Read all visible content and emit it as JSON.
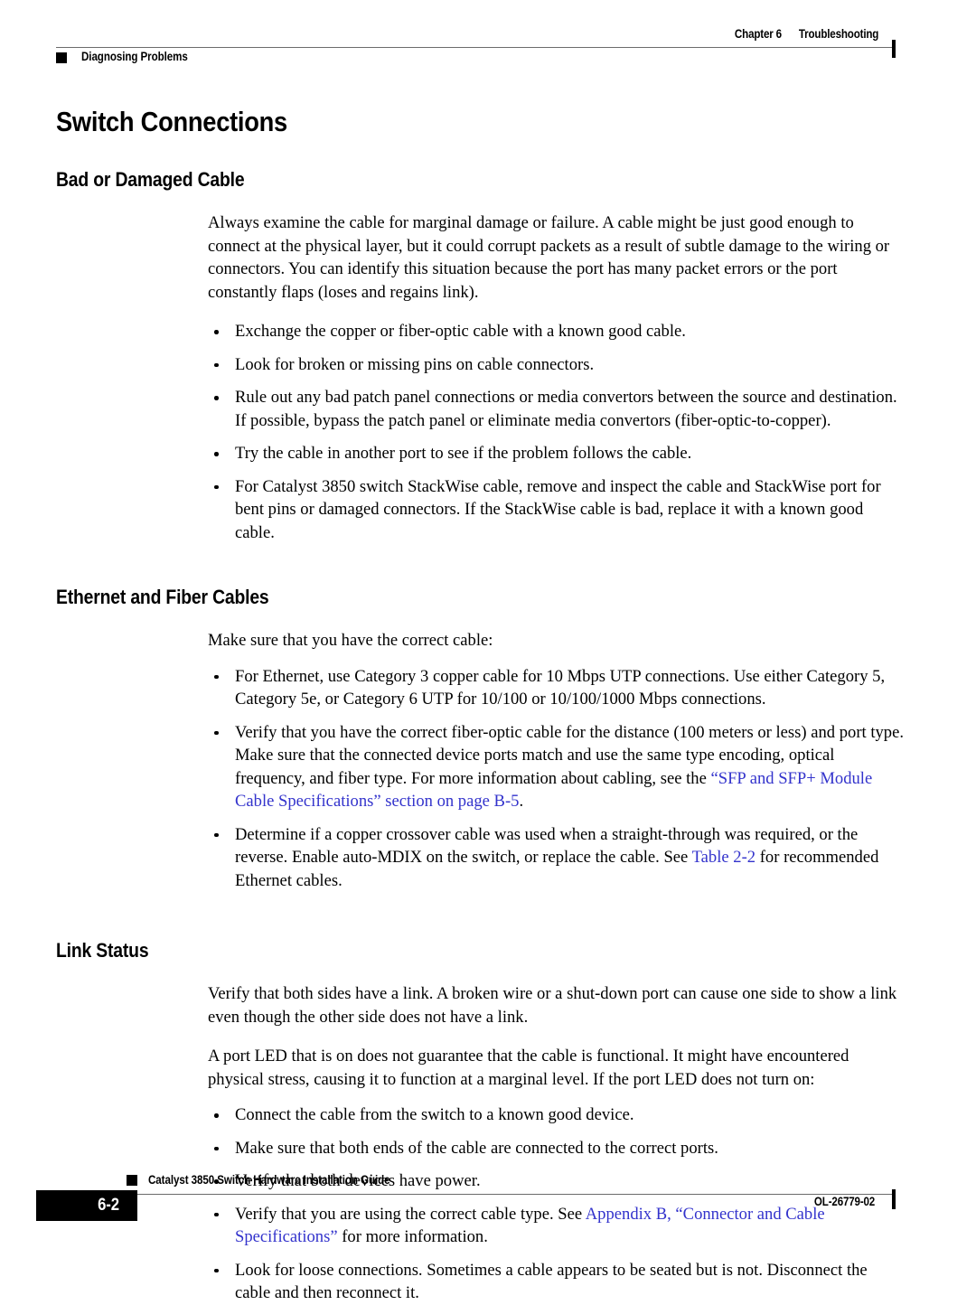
{
  "header": {
    "chapter_number": "Chapter 6",
    "chapter_title": "Troubleshooting",
    "section_name": "Diagnosing Problems"
  },
  "footer": {
    "guide_title": "Catalyst 3850 Switch Hardware Installation Guide",
    "page_number": "6-2",
    "document_id": "OL-26779-02"
  },
  "colors": {
    "text": "#000000",
    "link": "#3333CC",
    "rule": "#6B6B6B",
    "page_box": "#000000"
  },
  "page_title": "Switch Connections",
  "sections": [
    {
      "heading": "Bad or Damaged Cable",
      "intro": "Always examine the cable for marginal damage or failure. A cable might be just good enough to connect at the physical layer, but it could corrupt packets as a result of subtle damage to the wiring or connectors. You can identify this situation because the port has many packet errors or the port constantly flaps (loses and regains link).",
      "bullets": [
        "Exchange the copper or fiber-optic cable with a known good cable.",
        "Look for broken or missing pins on cable connectors.",
        "Rule out any bad patch panel connections or media convertors between the source and destination. If possible, bypass the patch panel or eliminate media convertors (fiber-optic-to-copper).",
        "Try the cable in another port to see if the problem follows the cable.",
        "For Catalyst 3850 switch StackWise cable, remove and inspect the cable and StackWise port for bent pins or damaged connectors. If the StackWise cable is bad, replace it with a known good cable."
      ]
    },
    {
      "heading": "Ethernet and Fiber Cables",
      "intro": "Make sure that you have the correct cable:",
      "bullets": [
        "For Ethernet, use Category 3 copper cable for 10 Mbps UTP connections. Use either Category 5, Category 5e, or Category 6 UTP for 10/100 or 10/100/1000 Mbps connections."
      ],
      "bullet_fiber": {
        "before": "Verify that you have the correct fiber-optic cable for the distance (100 meters or less) and port type. Make sure that the connected device ports match and use the same type encoding, optical frequency, and fiber type. For more information about cabling, see the ",
        "link": "“SFP and SFP+ Module Cable Specifications” section on page B-5",
        "after": "."
      },
      "bullet_mdix": {
        "before": "Determine if a copper crossover cable was used when a straight-through was required, or the reverse. Enable auto-MDIX on the switch, or replace the cable. See ",
        "link": "Table 2-2",
        "after": " for recommended Ethernet cables."
      }
    },
    {
      "heading": "Link Status",
      "para1": "Verify that both sides have a link. A broken wire or a shut-down port can cause one side to show a link even though the other side does not have a link.",
      "para2": "A port LED that is on does not guarantee that the cable is functional. It might have encountered physical stress, causing it to function at a marginal level. If the port LED does not turn on:",
      "bullets": [
        "Connect the cable from the switch to a known good device.",
        "Make sure that both ends of the cable are connected to the correct ports.",
        "Verify that both devices have power."
      ],
      "bullet_cabletype": {
        "before": "Verify that you are using the correct cable type. See ",
        "link": "Appendix B, “Connector and Cable Specifications”",
        "after": " for more information."
      },
      "bullet_last": "Look for loose connections. Sometimes a cable appears to be seated but is not. Disconnect the cable and then reconnect it."
    }
  ]
}
